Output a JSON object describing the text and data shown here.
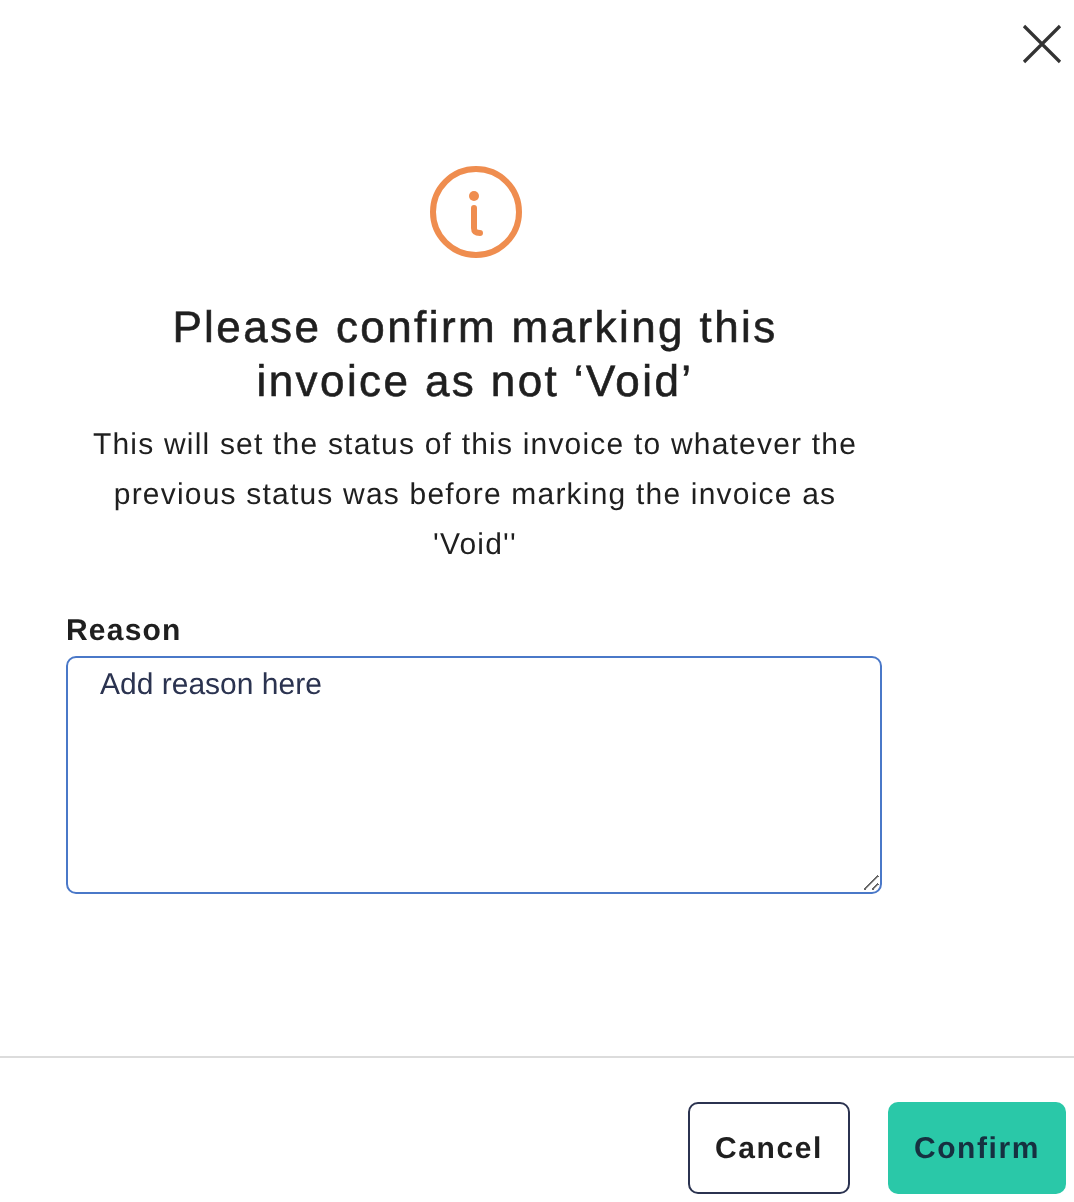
{
  "title": "Please confirm marking this invoice as not ‘Void’",
  "message": "This will set the status of this invoice to whatever the previous status was before marking the invoice as 'Void''",
  "reason": {
    "label": "Reason",
    "placeholder": "Add reason here"
  },
  "buttons": [
    {
      "label": "Cancel",
      "kind": "secondary"
    },
    {
      "label": "Confirm",
      "kind": "primary"
    }
  ]
}
